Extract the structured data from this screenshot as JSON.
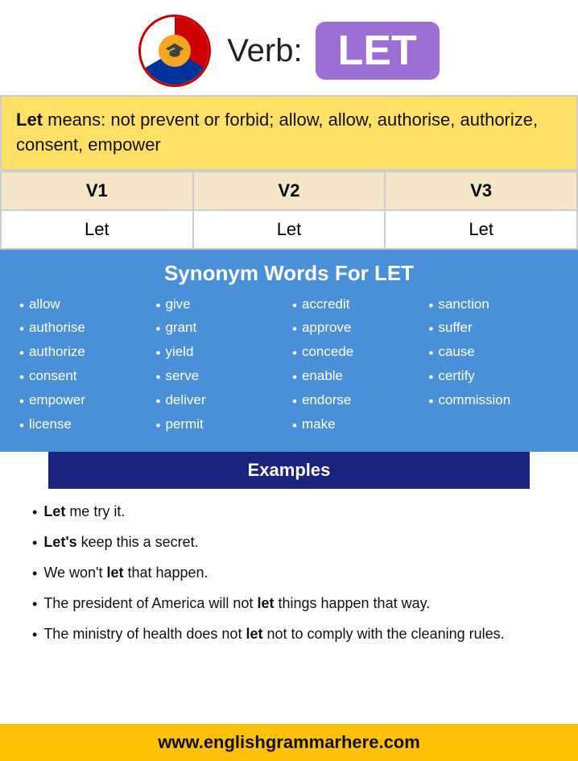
{
  "header": {
    "verb_label": "Verb:",
    "verb_word": "LET"
  },
  "definition": {
    "prefix": "Let",
    "text": " means: not prevent or forbid; allow, allow, authorise, authorize, consent, empower"
  },
  "verb_forms": {
    "headers": [
      "V1",
      "V2",
      "V3"
    ],
    "values": [
      "Let",
      "Let",
      "Let"
    ]
  },
  "synonyms": {
    "title_prefix": "Synonym Words For ",
    "title_bold": "LET",
    "columns": [
      [
        "allow",
        "authorise",
        "authorize",
        "consent",
        "empower",
        "license"
      ],
      [
        "give",
        "grant",
        "yield",
        "serve",
        "deliver",
        "permit"
      ],
      [
        "accredit",
        "approve",
        "concede",
        "enable",
        "endorse",
        "make"
      ],
      [
        "sanction",
        "suffer",
        "cause",
        "certify",
        "commission"
      ]
    ]
  },
  "examples": {
    "title": "Examples",
    "items": [
      {
        "text": "me try it.",
        "bold": "Let"
      },
      {
        "text": "keep this a secret.",
        "bold": "Let's"
      },
      {
        "text": "We won't ",
        "bold": "let",
        "suffix": " that happen."
      },
      {
        "text": "The president of America will not ",
        "bold": "let",
        "suffix": " things happen that way."
      },
      {
        "text": "The ministry of health does not ",
        "bold": "let",
        "suffix": " not to comply with the cleaning rules."
      }
    ]
  },
  "footer": {
    "url": "www.englishgrammarhere.com"
  }
}
